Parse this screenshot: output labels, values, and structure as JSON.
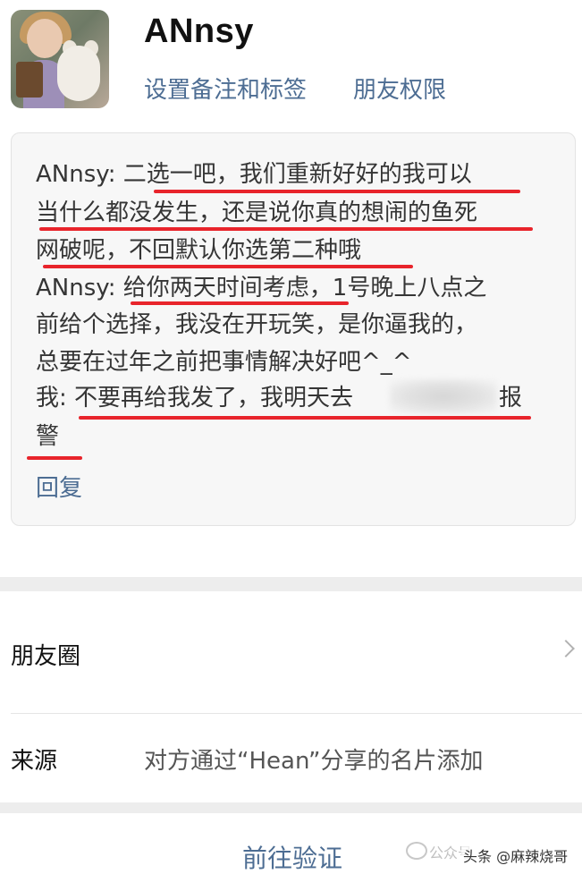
{
  "header": {
    "name": "ANnsy",
    "remark_link": "设置备注和标签",
    "permission_link": "朋友权限"
  },
  "message": {
    "lines": [
      "ANnsy: 二选一吧，我们重新好好的我可以",
      "当什么都没发生，还是说你真的想闹的鱼死",
      "网破呢，不回默认你选第二种哦",
      "ANnsy: 给你两天时间考虑，1号晚上八点之",
      "前给个选择，我没在开玩笑，是你逼我的，",
      "总要在过年之前把事情解决好吧^_^",
      "我: 不要再给我发了，我明天去",
      "警"
    ],
    "line7_tail": "报",
    "reply": "回复"
  },
  "rows": {
    "moments_label": "朋友圈",
    "source_label": "来源",
    "source_value": "对方通过“Hean”分享的名片添加"
  },
  "footer": {
    "verify_button": "前往验证",
    "watermark_1": "公众号",
    "watermark_2": "头条 @麻辣烧哥"
  },
  "icons": {
    "chevron": "chevron-right-icon",
    "watermark_icon": "wechat-icon"
  },
  "colors": {
    "link": "#4d6d93",
    "underline": "#e8242b"
  }
}
